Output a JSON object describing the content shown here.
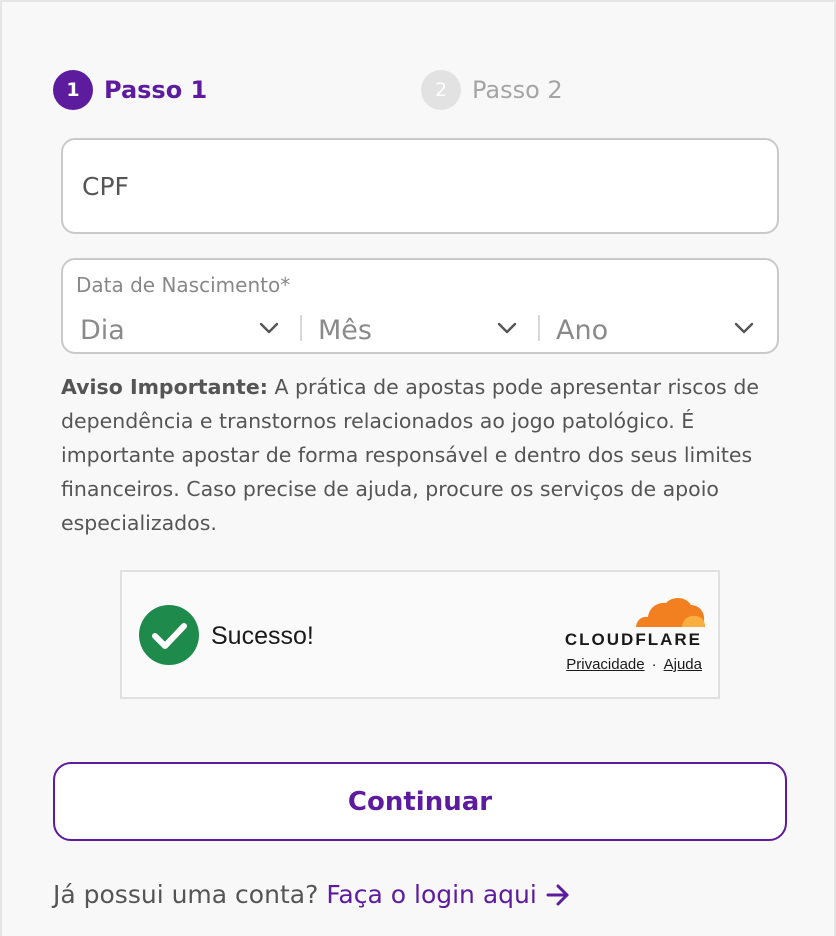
{
  "steps": {
    "step1": {
      "number": "1",
      "label": "Passo 1"
    },
    "step2": {
      "number": "2",
      "label": "Passo 2"
    }
  },
  "form": {
    "cpf_placeholder": "CPF",
    "birthdate": {
      "label": "Data de Nascimento*",
      "day": "Dia",
      "month": "Mês",
      "year": "Ano"
    }
  },
  "warning": {
    "title": "Aviso Importante:",
    "body": " A prática de apostas pode apresentar riscos de dependência e transtornos relacionados ao jogo patológico. É importante apostar de forma responsável e dentro dos seus limites financeiros. Caso precise de ajuda, procure os serviços de apoio especializados."
  },
  "captcha": {
    "status": "Sucesso!",
    "brand": "CLOUDFLARE",
    "privacy_link": "Privacidade",
    "separator": "·",
    "help_link": "Ajuda"
  },
  "actions": {
    "continue_label": "Continuar",
    "login_prompt": "Já possui uma conta?",
    "login_link": "Faça o login aqui"
  },
  "colors": {
    "brand_purple": "#5d1b9e",
    "success_green": "#1e8a4c",
    "cloudflare_orange": "#f38020"
  }
}
